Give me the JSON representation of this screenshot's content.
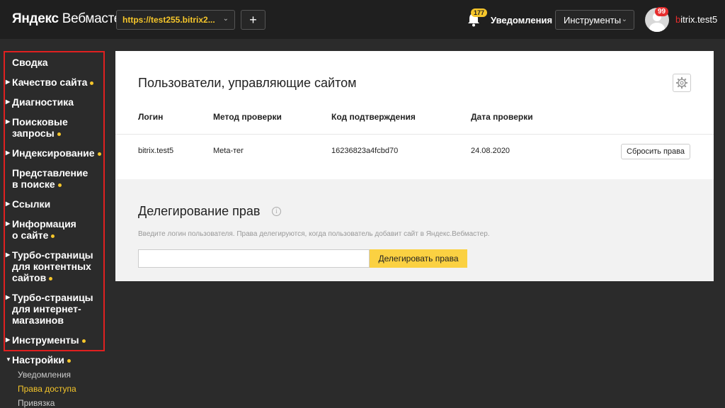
{
  "header": {
    "logo_brand": "Яндекс",
    "logo_product": "Вебмастер",
    "site_url": "https://test255.bitrix2...",
    "add_label": "+",
    "notifications_count": "177",
    "notifications_label": "Уведомления",
    "tools_label": "Инструменты",
    "avatar_badge": "99",
    "username_first": "b",
    "username_rest": "itrix.test5"
  },
  "sidebar": {
    "items": [
      {
        "label": "Сводка",
        "has_arrow": false,
        "dot": false
      },
      {
        "label": "Качество сайта",
        "has_arrow": true,
        "dot": true
      },
      {
        "label": "Диагностика",
        "has_arrow": true,
        "dot": false
      },
      {
        "label": "Поисковые запросы",
        "has_arrow": true,
        "dot": true
      },
      {
        "label": "Индексирование",
        "has_arrow": true,
        "dot": true
      },
      {
        "label": "Представление в поиске",
        "has_arrow": false,
        "dot": true
      },
      {
        "label": "Ссылки",
        "has_arrow": true,
        "dot": false
      },
      {
        "label": "Информация о сайте",
        "has_arrow": true,
        "dot": true
      },
      {
        "label": "Турбо-страницы для контентных сайтов",
        "has_arrow": true,
        "dot": true
      },
      {
        "label": "Турбо-страницы для интернет-магазинов",
        "has_arrow": true,
        "dot": false
      },
      {
        "label": "Инструменты",
        "has_arrow": true,
        "dot": true
      },
      {
        "label": "Настройки",
        "has_arrow": true,
        "dot": true
      }
    ],
    "sub_items": [
      {
        "label": "Уведомления",
        "active": false
      },
      {
        "label": "Права доступа",
        "active": true
      },
      {
        "label": "Привязка",
        "active": false
      }
    ]
  },
  "users": {
    "title": "Пользователи, управляющие сайтом",
    "columns": [
      "Логин",
      "Метод проверки",
      "Код подтверждения",
      "Дата проверки"
    ],
    "rows": [
      {
        "login": "bitrix.test5",
        "method": "Meta-тег",
        "code": "16236823a4fcbd70",
        "date": "24.08.2020",
        "action": "Сбросить права"
      }
    ]
  },
  "delegation": {
    "title": "Делегирование прав",
    "hint": "Введите логин пользователя. Права делегируются, когда пользователь добавит сайт в Яндекс.Вебмастер.",
    "input_value": "",
    "input_placeholder": "",
    "button_label": "Делегировать права"
  },
  "colors": {
    "accent": "#f6c62b",
    "highlight_border": "#e02020",
    "header_bg": "#1f1f1f",
    "page_bg": "#2b2b2b",
    "badge_red": "#e62e2e"
  }
}
